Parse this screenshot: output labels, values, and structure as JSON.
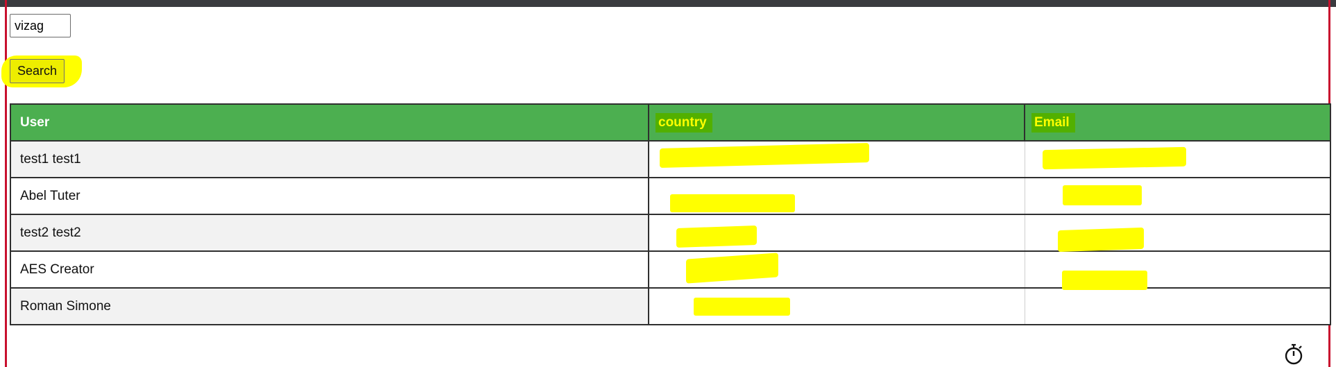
{
  "search": {
    "value": "vizag",
    "button_label": "Search"
  },
  "table": {
    "headers": [
      "User",
      "country",
      "Email"
    ],
    "rows": [
      {
        "user": "test1 test1"
      },
      {
        "user": "Abel Tuter"
      },
      {
        "user": "test2 test2"
      },
      {
        "user": "AES Creator"
      },
      {
        "user": "Roman Simone"
      }
    ]
  },
  "colors": {
    "header_bg": "#4caf50",
    "highlight": "#ffff00",
    "frame": "#c8102e",
    "topbar": "#3a3b3f"
  },
  "icons": {
    "timer": "stopwatch-icon"
  }
}
